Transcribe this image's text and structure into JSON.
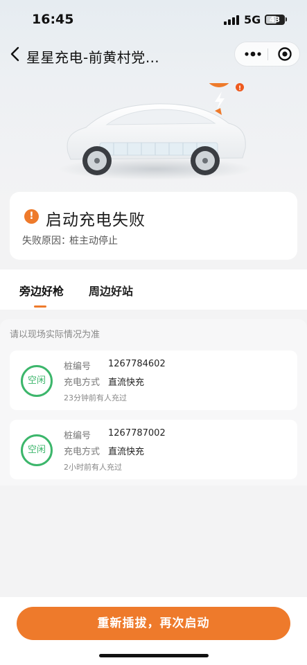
{
  "status_bar": {
    "time": "16:45",
    "network": "5G",
    "battery": "43"
  },
  "nav": {
    "title": "星星充电-前黄村党…",
    "back_icon": "chevron-left-icon",
    "menu_icon": "more-dots-icon",
    "close_icon": "target-close-icon"
  },
  "hero": {
    "badge_icon": "lightning-alert-icon"
  },
  "status_card": {
    "title": "启动充电失败",
    "reason_label": "失败原因：",
    "reason_value": "桩主动停止",
    "icon": "warning-icon",
    "accent_color": "#ee7a2b"
  },
  "tabs": [
    {
      "label": "旁边好枪",
      "active": true
    },
    {
      "label": "周边好站",
      "active": false
    }
  ],
  "notice": "请以现场实际情况为准",
  "guns": [
    {
      "status": "空闲",
      "pile_label": "桩编号",
      "pile_no": "1267784602",
      "mode_label": "充电方式",
      "mode": "直流快充",
      "last_used": "23分钟前有人充过"
    },
    {
      "status": "空闲",
      "pile_label": "桩编号",
      "pile_no": "1267787002",
      "mode_label": "充电方式",
      "mode": "直流快充",
      "last_used": "2小时前有人充过"
    }
  ],
  "cta": {
    "label": "重新插拔，再次启动",
    "color": "#ee7a2b"
  },
  "colors": {
    "free_status": "#3cb66b",
    "background": "#f3f3f4"
  }
}
